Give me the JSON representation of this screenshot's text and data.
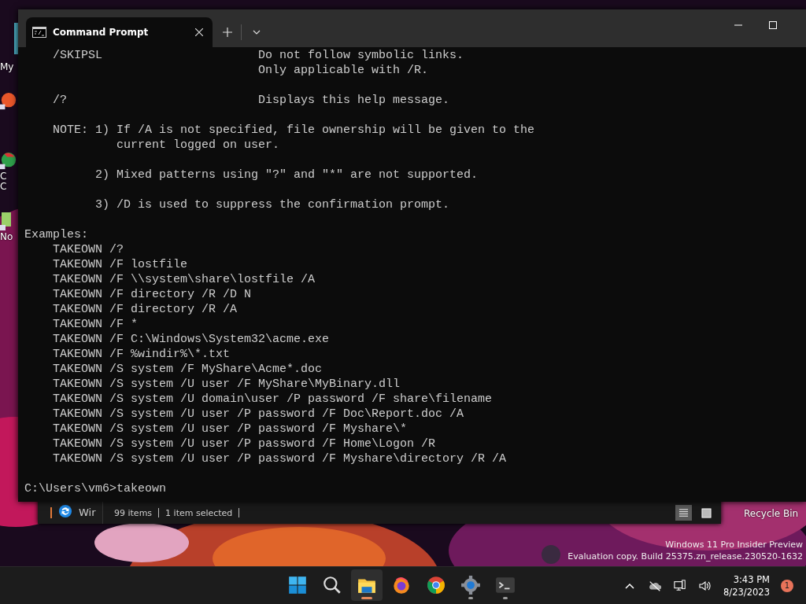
{
  "desktop_icons": [
    {
      "kind": "folder",
      "label": "My"
    },
    {
      "kind": "orange"
    },
    {
      "kind": "green",
      "label": "C C"
    },
    {
      "kind": "notepad",
      "label": "No"
    }
  ],
  "explorer": {
    "nav_item": "Wir",
    "status": [
      "99 items",
      "1 item selected"
    ],
    "views": [
      {
        "kind": "details",
        "selected": true
      },
      {
        "kind": "tiles",
        "selected": false
      }
    ]
  },
  "terminal": {
    "tabs": [
      {
        "title": "Command Prompt",
        "selected": true
      }
    ],
    "blocks": [
      [
        "    /SKIPSL                      Do not follow symbolic links.",
        "                                 Only applicable with /R."
      ],
      [
        "    /?                           Displays this help message."
      ],
      [
        "    NOTE: 1) If /A is not specified, file ownership will be given to the",
        "             current logged on user."
      ],
      [
        "          2) Mixed patterns using \"?\" and \"*\" are not supported."
      ],
      [
        "          3) /D is used to suppress the confirmation prompt."
      ],
      [
        "Examples:",
        "    TAKEOWN /?",
        "    TAKEOWN /F lostfile",
        "    TAKEOWN /F \\\\system\\share\\lostfile /A",
        "    TAKEOWN /F directory /R /D N",
        "    TAKEOWN /F directory /R /A",
        "    TAKEOWN /F *",
        "    TAKEOWN /F C:\\Windows\\System32\\acme.exe",
        "    TAKEOWN /F %windir%\\*.txt",
        "    TAKEOWN /S system /F MyShare\\Acme*.doc",
        "    TAKEOWN /S system /U user /F MyShare\\MyBinary.dll",
        "    TAKEOWN /S system /U domain\\user /P password /F share\\filename",
        "    TAKEOWN /S system /U user /P password /F Doc\\Report.doc /A",
        "    TAKEOWN /S system /U user /P password /F Myshare\\*",
        "    TAKEOWN /S system /U user /P password /F Home\\Logon /R",
        "    TAKEOWN /S system /U user /P password /F Myshare\\directory /R /A"
      ],
      [
        "C:\\Users\\vm6>takeown"
      ]
    ]
  },
  "recycle_bin": {
    "label": "Recycle Bin"
  },
  "watermark": [
    "Windows 11 Pro Insider Preview",
    "Evaluation copy. Build 25375.zn_release.230520-1632"
  ],
  "taskbar": {
    "apps": [
      {
        "kind": "start",
        "selected": false,
        "running": false
      },
      {
        "kind": "search",
        "selected": false,
        "running": false
      },
      {
        "kind": "explorer",
        "selected": true,
        "running": true
      },
      {
        "kind": "firefox",
        "selected": false,
        "running": false
      },
      {
        "kind": "chrome",
        "selected": false,
        "running": false
      },
      {
        "kind": "settings",
        "selected": false,
        "running": true
      },
      {
        "kind": "terminal",
        "selected": false,
        "running": true
      }
    ],
    "time": "3:43 PM",
    "date": "8/23/2023",
    "notifications": "1"
  }
}
